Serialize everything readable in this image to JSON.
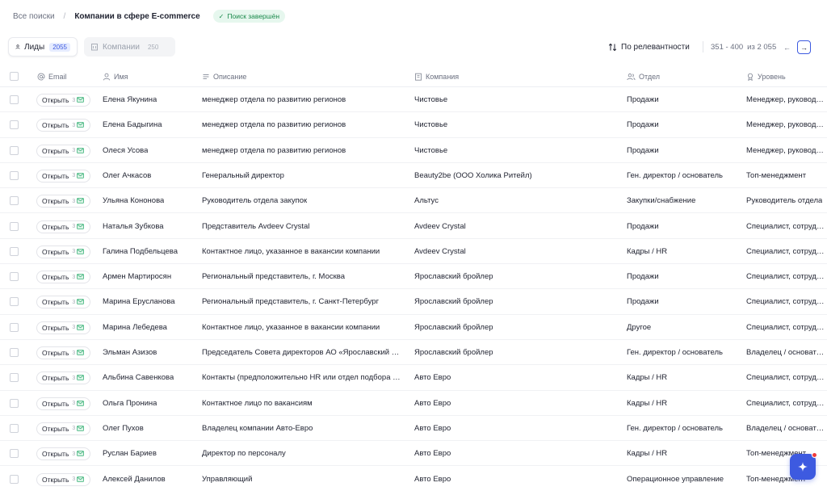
{
  "breadcrumb": {
    "root": "Все поиски",
    "separator": "/",
    "current": "Компании в сфере E-commerce",
    "status": "Поиск завершён"
  },
  "tabs": [
    {
      "label": "Лиды",
      "count": "2055",
      "active": true
    },
    {
      "label": "Компании",
      "count": "250",
      "active": false
    }
  ],
  "sort": {
    "label": "По релевантности"
  },
  "pagination": {
    "range": "351 - 400",
    "of_label": "из 2 055"
  },
  "columns": {
    "email": "Email",
    "name": "Имя",
    "description": "Описание",
    "company": "Компания",
    "department": "Отдел",
    "level": "Уровень"
  },
  "open_label": "Открыть",
  "open_count": "3",
  "rows": [
    {
      "name": "Елена Якунина",
      "description": "менеджер отдела по развитию регионов",
      "company": "Чистовье",
      "department": "Продажи",
      "level": "Менеджер, руководитель"
    },
    {
      "name": "Елена Бадыгина",
      "description": "менеджер отдела по развитию регионов",
      "company": "Чистовье",
      "department": "Продажи",
      "level": "Менеджер, руководитель"
    },
    {
      "name": "Олеся Усова",
      "description": "менеджер отдела по развитию регионов",
      "company": "Чистовье",
      "department": "Продажи",
      "level": "Менеджер, руководитель"
    },
    {
      "name": "Олег Ачкасов",
      "description": "Генеральный директор",
      "company": "Beauty2be (ООО Холика Ритейл)",
      "department": "Ген. директор / основатель",
      "level": "Топ-менеджмент"
    },
    {
      "name": "Ульяна Кононова",
      "description": "Руководитель отдела закупок",
      "company": "Альтус",
      "department": "Закупки/снабжение",
      "level": "Руководитель отдела"
    },
    {
      "name": "Наталья Зубкова",
      "description": "Представитель Avdeev Crystal",
      "company": "Avdeev Crystal",
      "department": "Продажи",
      "level": "Специалист, сотрудник"
    },
    {
      "name": "Галина Подбельцева",
      "description": "Контактное лицо, указанное в вакансии компании",
      "company": "Avdeev Crystal",
      "department": "Кадры / HR",
      "level": "Специалист, сотрудник"
    },
    {
      "name": "Армен Мартиросян",
      "description": "Региональный представитель, г. Москва",
      "company": "Ярославский бройлер",
      "department": "Продажи",
      "level": "Специалист, сотрудник"
    },
    {
      "name": "Марина Ерусланова",
      "description": "Региональный представитель, г. Санкт-Петербург",
      "company": "Ярославский бройлер",
      "department": "Продажи",
      "level": "Специалист, сотрудник"
    },
    {
      "name": "Марина Лебедева",
      "description": "Контактное лицо, указанное в вакансии компании",
      "company": "Ярославский бройлер",
      "department": "Другое",
      "level": "Специалист, сотрудник"
    },
    {
      "name": "Эльман Азизов",
      "description": "Председатель Совета директоров АО «Ярославский бройлер»",
      "company": "Ярославский бройлер",
      "department": "Ген. директор / основатель",
      "level": "Владелец / основатель"
    },
    {
      "name": "Альбина Савенкова",
      "description": "Контакты (предположительно HR или отдел подбора персонала)",
      "company": "Авто Евро",
      "department": "Кадры / HR",
      "level": "Специалист, сотрудник"
    },
    {
      "name": "Ольга Пронина",
      "description": "Контактное лицо по вакансиям",
      "company": "Авто Евро",
      "department": "Кадры / HR",
      "level": "Специалист, сотрудник"
    },
    {
      "name": "Олег Пухов",
      "description": "Владелец компании Авто-Евро",
      "company": "Авто Евро",
      "department": "Ген. директор / основатель",
      "level": "Владелец / основатель"
    },
    {
      "name": "Руслан Бариев",
      "description": "Директор по персоналу",
      "company": "Авто Евро",
      "department": "Кадры / HR",
      "level": "Топ-менеджмент"
    },
    {
      "name": "Алексей Данилов",
      "description": "Управляющий",
      "company": "Авто Евро",
      "department": "Операционное управление",
      "level": "Топ-менеджмент"
    }
  ],
  "colors": {
    "accent": "#3d5ae0",
    "success": "#1b8a4c",
    "notification": "#ef3b3b"
  }
}
